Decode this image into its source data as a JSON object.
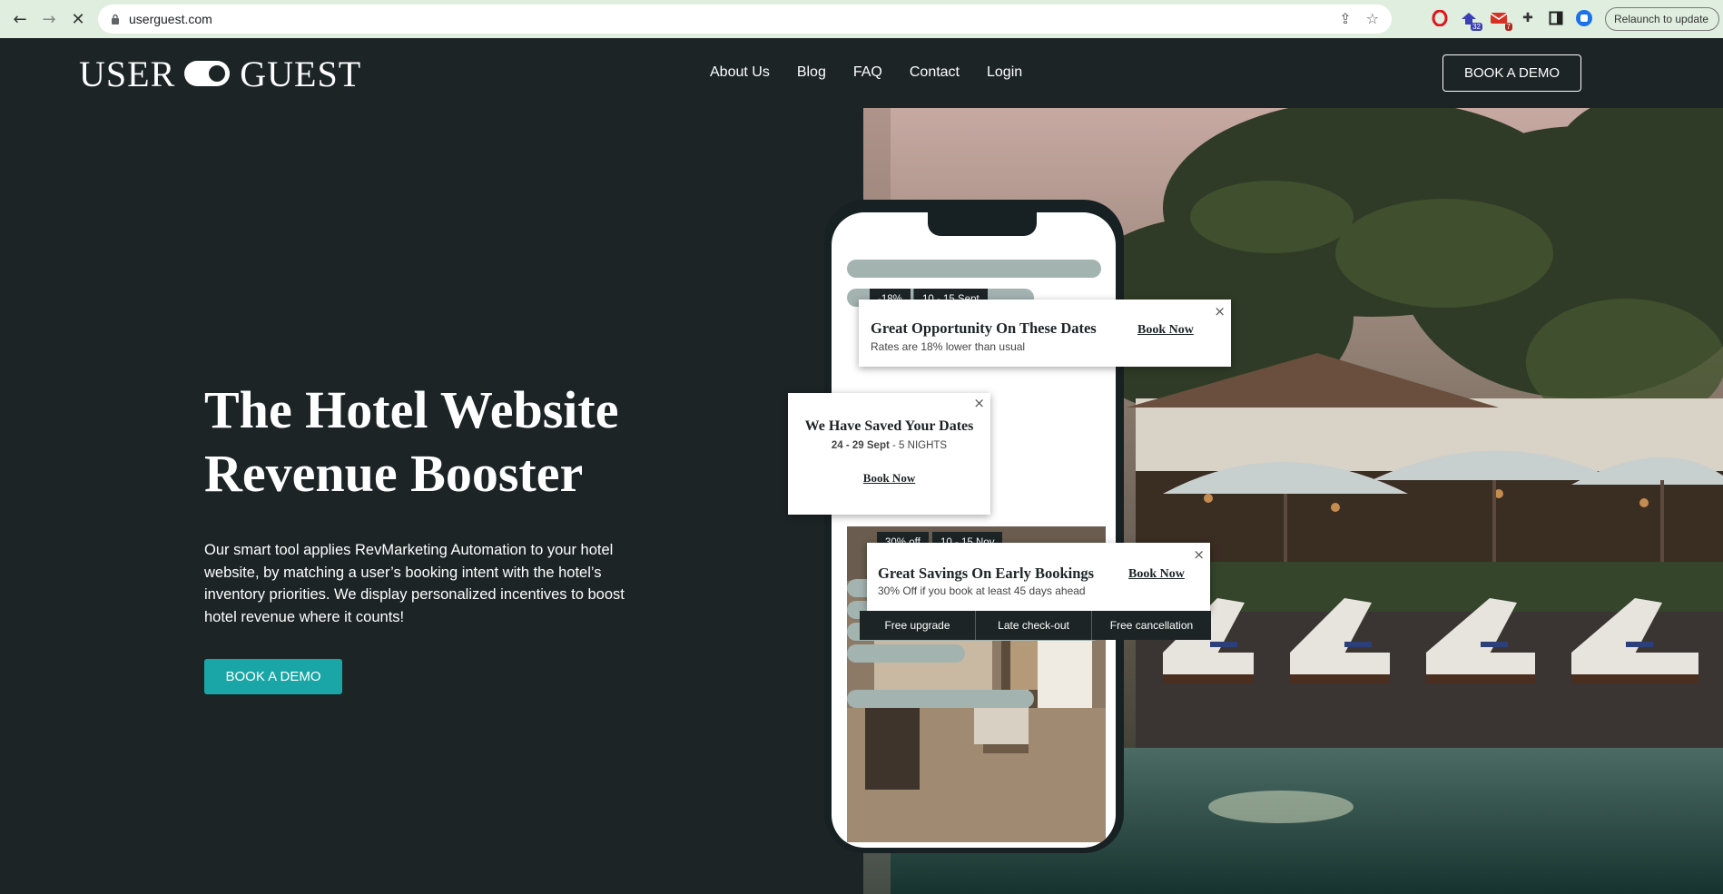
{
  "browser": {
    "url": "userguest.com",
    "relaunch_label": "Relaunch to update",
    "ext_badges": {
      "ext2": "32",
      "ext3": "7"
    }
  },
  "header": {
    "logo_left": "USER",
    "logo_right": "GUEST",
    "nav": [
      "About Us",
      "Blog",
      "FAQ",
      "Contact",
      "Login"
    ],
    "cta": "BOOK A DEMO"
  },
  "hero": {
    "title_line1": "The Hotel Website",
    "title_line2": "Revenue Booster",
    "body": "Our smart tool applies RevMarketing Automation to your hotel website, by matching a user’s booking intent with the hotel’s inventory priorities. We display personalized incentives to boost hotel revenue where it counts!",
    "cta": "BOOK A DEMO"
  },
  "popups": {
    "top": {
      "tag1": "-18%",
      "tag2": "10 - 15 Sept",
      "title": "Great Opportunity On These Dates",
      "subtitle": "Rates are 18% lower than usual",
      "link": "Book Now"
    },
    "middle": {
      "title": "We Have Saved Your Dates",
      "dates": "24 - 29 Sept",
      "sep": " - ",
      "nights": "5 NIGHTS",
      "link": "Book Now"
    },
    "bottom": {
      "tag1": "30% off",
      "tag2": "10 - 15 Nov",
      "title": "Great Savings On Early Bookings",
      "subtitle": "30% Off if you book at least 45 days ahead",
      "link": "Book Now",
      "perks": [
        "Free upgrade",
        "Late check-out",
        "Free cancellation"
      ]
    }
  },
  "colors": {
    "background": "#1c2426",
    "accent": "#1aa6a6",
    "skeleton": "#a3b3b0",
    "chrome": "#dfeede"
  }
}
